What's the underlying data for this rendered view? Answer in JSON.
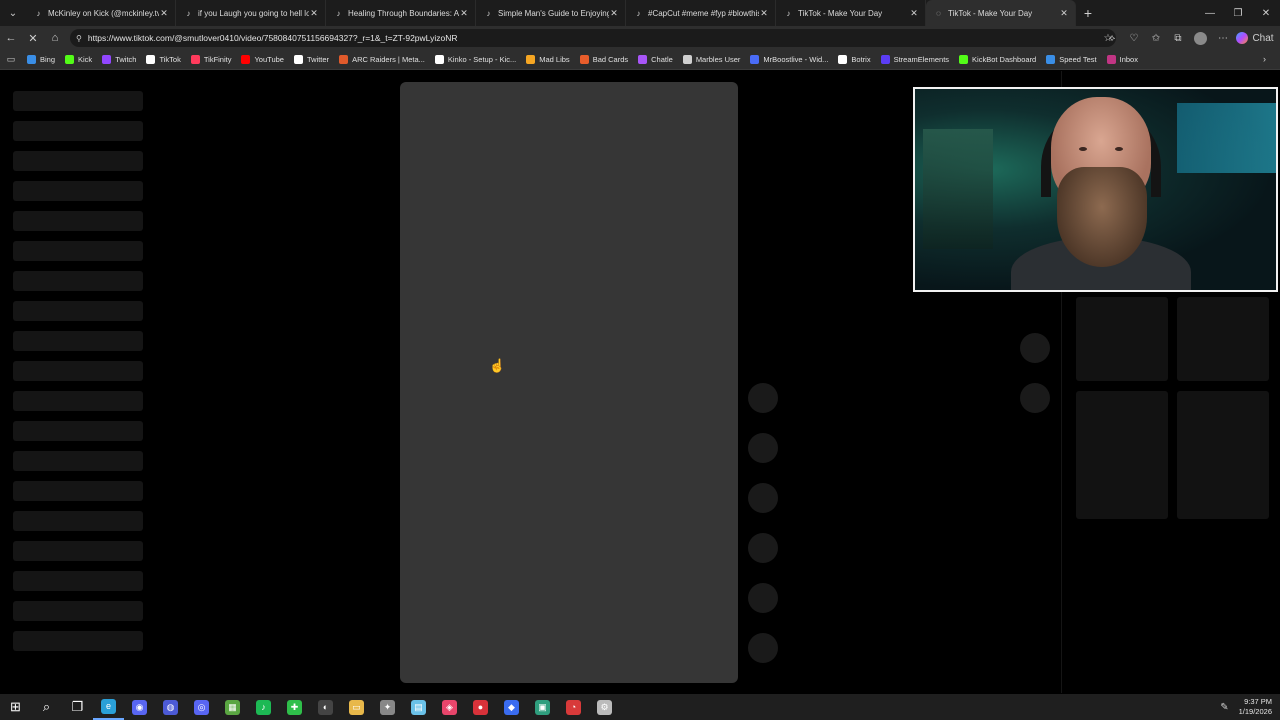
{
  "browser": {
    "tabs": [
      {
        "title": "McKinley on Kick (@mckinley.tv) | ",
        "favicon": "tiktok-icon",
        "active": false
      },
      {
        "title": "if you Laugh you going to hell lol",
        "favicon": "tiktok-icon",
        "active": false
      },
      {
        "title": "Healing Through Boundaries: A Jo",
        "favicon": "tiktok-icon",
        "active": false
      },
      {
        "title": "Simple Man's Guide to Enjoying H",
        "favicon": "tiktok-icon",
        "active": false
      },
      {
        "title": "#CapCut #meme #fyp #blowthisu",
        "favicon": "tiktok-icon",
        "active": false
      },
      {
        "title": "TikTok - Make Your Day",
        "favicon": "tiktok-icon",
        "active": false
      },
      {
        "title": "TikTok - Make Your Day",
        "favicon": "loading-icon",
        "active": true
      }
    ],
    "address": {
      "url": "https://www.tiktok.com/@smutlover0410/video/7580840751156694327?_r=1&_t=ZT-92pwLyizoNR"
    },
    "copilot_label": "Chat",
    "bookmarks": [
      {
        "label": "Bing",
        "icon": "bing-icon",
        "color": "#3a8ee6"
      },
      {
        "label": "Kick",
        "icon": "kick-icon",
        "color": "#53fc18"
      },
      {
        "label": "Twitch",
        "icon": "twitch-icon",
        "color": "#9146ff"
      },
      {
        "label": "TikTok",
        "icon": "tiktok-icon",
        "color": "#ffffff"
      },
      {
        "label": "TikFinity",
        "icon": "tikfinity-icon",
        "color": "#ff3b5c"
      },
      {
        "label": "YouTube",
        "icon": "youtube-icon",
        "color": "#ff0000"
      },
      {
        "label": "Twitter",
        "icon": "x-icon",
        "color": "#ffffff"
      },
      {
        "label": "ARC Raiders | Meta...",
        "icon": "arc-raiders-icon",
        "color": "#e05a2b"
      },
      {
        "label": "Kinko - Setup - Kic...",
        "icon": "kinko-icon",
        "color": "#ffffff"
      },
      {
        "label": "Mad Libs",
        "icon": "mad-libs-icon",
        "color": "#f5a623"
      },
      {
        "label": "Bad Cards",
        "icon": "bad-cards-icon",
        "color": "#e85d2b"
      },
      {
        "label": "Chatle",
        "icon": "chatle-icon",
        "color": "#a855f7"
      },
      {
        "label": "Marbles User",
        "icon": "globe-icon",
        "color": "#cfcfcf"
      },
      {
        "label": "MrBoostlive - Wid...",
        "icon": "mrboost-icon",
        "color": "#4a6cf7"
      },
      {
        "label": "Botrix",
        "icon": "botrix-icon",
        "color": "#ffffff"
      },
      {
        "label": "StreamElements",
        "icon": "streamelements-icon",
        "color": "#5b3df5"
      },
      {
        "label": "KickBot Dashboard",
        "icon": "kickbot-icon",
        "color": "#53fc18"
      },
      {
        "label": "Speed Test",
        "icon": "speedtest-icon",
        "color": "#3a8ee6"
      },
      {
        "label": "Inbox",
        "icon": "inbox-icon",
        "color": "#c13584"
      }
    ]
  },
  "taskbar": {
    "apps": [
      {
        "name": "start-icon",
        "color": "#ffffff",
        "glyph": "⊞"
      },
      {
        "name": "search-icon",
        "color": "#ffffff",
        "glyph": "⌕"
      },
      {
        "name": "task-view-icon",
        "color": "#ffffff",
        "glyph": "❐"
      },
      {
        "name": "edge-icon",
        "color": "#2aa0d8",
        "glyph": "e",
        "active": true
      },
      {
        "name": "discord-icon",
        "color": "#5865f2",
        "glyph": "◉"
      },
      {
        "name": "app-icon-1",
        "color": "#4c5ad6",
        "glyph": "◍"
      },
      {
        "name": "app-icon-2",
        "color": "#5865f2",
        "glyph": "◎"
      },
      {
        "name": "minecraft-icon",
        "color": "#5aa642",
        "glyph": "▦"
      },
      {
        "name": "spotify-icon",
        "color": "#1db954",
        "glyph": "♪"
      },
      {
        "name": "app-icon-3",
        "color": "#2fbf4a",
        "glyph": "✚"
      },
      {
        "name": "obs-icon",
        "color": "#444444",
        "glyph": "◐"
      },
      {
        "name": "file-explorer-icon",
        "color": "#e8b84a",
        "glyph": "▭"
      },
      {
        "name": "app-icon-4",
        "color": "#888888",
        "glyph": "✦"
      },
      {
        "name": "notepad-icon",
        "color": "#6ac1e8",
        "glyph": "▤"
      },
      {
        "name": "app-icon-5",
        "color": "#e8456b",
        "glyph": "◈"
      },
      {
        "name": "app-icon-6",
        "color": "#d8323a",
        "glyph": "●"
      },
      {
        "name": "app-icon-7",
        "color": "#3a6cf0",
        "glyph": "◆"
      },
      {
        "name": "app-icon-8",
        "color": "#2f9e7e",
        "glyph": "▣"
      },
      {
        "name": "app-icon-9",
        "color": "#d83a3a",
        "glyph": "◔"
      },
      {
        "name": "settings-icon",
        "color": "#bbbbbb",
        "glyph": "⚙"
      }
    ],
    "time": "9:37 PM",
    "date": "1/19/2026"
  }
}
